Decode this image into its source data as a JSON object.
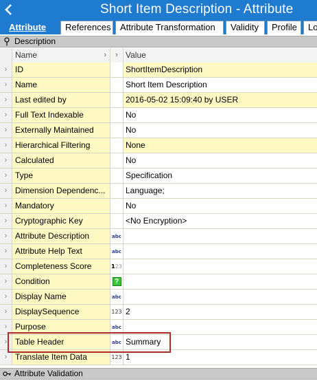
{
  "window": {
    "title": "Short Item Description - Attribute",
    "back_icon": "chevron-left-icon"
  },
  "tabs": [
    {
      "label": "Attribute",
      "active": true
    },
    {
      "label": "References",
      "active": false
    },
    {
      "label": "Attribute Transformation",
      "active": false
    },
    {
      "label": "Validity",
      "active": false
    },
    {
      "label": "Profile",
      "active": false
    },
    {
      "label": "Lo",
      "active": false
    }
  ],
  "sections": {
    "description": {
      "label": "Description",
      "icon": "pin-icon"
    },
    "validation": {
      "label": "Attribute Validation",
      "icon": "key-icon"
    }
  },
  "grid": {
    "header": {
      "name": "Name",
      "chevron": "›",
      "value": "Value"
    },
    "rows": [
      {
        "name": "ID",
        "type": "",
        "value": "ShortItemDescription",
        "bg": "yellow"
      },
      {
        "name": "Name",
        "type": "",
        "value": "Short Item Description",
        "bg": "white"
      },
      {
        "name": "Last edited by",
        "type": "",
        "value": "2016-05-02 15:09:40 by USER",
        "bg": "yellow"
      },
      {
        "name": "Full Text Indexable",
        "type": "",
        "value": "No",
        "bg": "white"
      },
      {
        "name": "Externally Maintained",
        "type": "",
        "value": "No",
        "bg": "white"
      },
      {
        "name": "Hierarchical Filtering",
        "type": "",
        "value": "None",
        "bg": "yellow"
      },
      {
        "name": "Calculated",
        "type": "",
        "value": "No",
        "bg": "white"
      },
      {
        "name": "Type",
        "type": "",
        "value": "Specification",
        "bg": "white"
      },
      {
        "name": "Dimension Dependenc...",
        "type": "",
        "value": "Language;",
        "bg": "white"
      },
      {
        "name": "Mandatory",
        "type": "",
        "value": "No",
        "bg": "white"
      },
      {
        "name": "Cryptographic Key",
        "type": "",
        "value": "<No Encryption>",
        "bg": "white"
      },
      {
        "name": "Attribute Description",
        "type": "abc",
        "value": "",
        "bg": "white"
      },
      {
        "name": "Attribute Help Text",
        "type": "abc",
        "value": "",
        "bg": "white"
      },
      {
        "name": "Completeness Score",
        "type": "b123",
        "value": "",
        "bg": "white"
      },
      {
        "name": "Condition",
        "type": "cond",
        "value": "",
        "bg": "white"
      },
      {
        "name": "Display Name",
        "type": "abc",
        "value": "",
        "bg": "white"
      },
      {
        "name": "DisplaySequence",
        "type": "123",
        "value": "2",
        "bg": "white"
      },
      {
        "name": "Purpose",
        "type": "abc",
        "value": "",
        "bg": "white"
      },
      {
        "name": "Table Header",
        "type": "abc",
        "value": "Summary",
        "bg": "white"
      },
      {
        "name": "Translate Item Data",
        "type": "123",
        "value": "1",
        "bg": "white"
      }
    ]
  },
  "colors": {
    "titlebar": "#1f7bd0",
    "name_cell": "#fff9c4",
    "highlight": "#b12a2a"
  }
}
